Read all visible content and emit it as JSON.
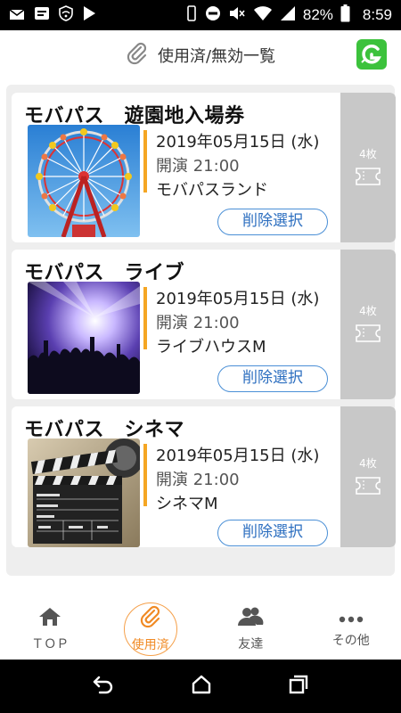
{
  "status_bar": {
    "battery_percent": "82%",
    "time": "8:59"
  },
  "header": {
    "title": "使用済/無効一覧"
  },
  "tickets": [
    {
      "title": "モバパス　遊園地入場券",
      "date": "2019年05月15日 (水)",
      "start": "開演 21:00",
      "venue": "モバパスランド",
      "count": "4枚",
      "delete_label": "削除選択"
    },
    {
      "title": "モバパス　ライブ",
      "date": "2019年05月15日 (水)",
      "start": "開演 21:00",
      "venue": "ライブハウスM",
      "count": "4枚",
      "delete_label": "削除選択"
    },
    {
      "title": "モバパス　シネマ",
      "date": "2019年05月15日 (水)",
      "start": "開演 21:00",
      "venue": "シネマM",
      "count": "4枚",
      "delete_label": "削除選択"
    }
  ],
  "bottom_nav": {
    "items": [
      {
        "label": "ＴＯＰ",
        "icon": "home-icon"
      },
      {
        "label": "使用済",
        "icon": "paperclip-icon",
        "active": true
      },
      {
        "label": "友達",
        "icon": "friends-icon"
      },
      {
        "label": "その他",
        "icon": "more-icon"
      }
    ]
  },
  "colors": {
    "accent_orange": "#f5a623",
    "button_blue": "#4a8fd6",
    "side_gray": "#c8c8c8",
    "logo_green": "#3cc23c"
  }
}
